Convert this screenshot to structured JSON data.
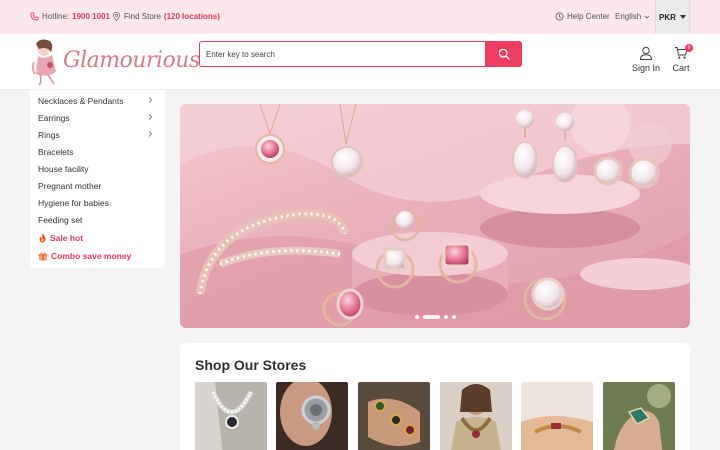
{
  "topbar": {
    "hotline_label": "Hotline:",
    "hotline_number": "1900 1001",
    "find_store_label": "Find Store",
    "store_count": "(120 locations)",
    "help_center": "Help Center",
    "language": "English",
    "currency": "PKR"
  },
  "header": {
    "logo_text": "Glamourious",
    "search_placeholder": "Enter key to search",
    "signin_label": "Sign In",
    "cart_label": "Cart",
    "cart_count": "0"
  },
  "sidebar": {
    "items": [
      {
        "label": "Necklaces & Pendants",
        "has_submenu": true
      },
      {
        "label": "Earrings",
        "has_submenu": true
      },
      {
        "label": "Rings",
        "has_submenu": true
      },
      {
        "label": "Bracelets",
        "has_submenu": false
      },
      {
        "label": "House facility",
        "has_submenu": false
      },
      {
        "label": "Pregnant mother",
        "has_submenu": false
      },
      {
        "label": "Hygiene for babies",
        "has_submenu": false
      },
      {
        "label": "Feeding set",
        "has_submenu": false
      }
    ],
    "promos": [
      {
        "label": "Sale hot",
        "icon": "fire-icon"
      },
      {
        "label": "Combo save money",
        "icon": "gift-icon"
      }
    ]
  },
  "banner": {
    "slide_count": 4,
    "active_slide": 2
  },
  "stores": {
    "title": "Shop Our Stores",
    "thumbnails": [
      "necklace-photo",
      "earring-photo",
      "rings-photo",
      "jewelry-set-photo",
      "bracelet-photo",
      "gemstone-photo"
    ]
  },
  "colors": {
    "accent": "#ef3e62",
    "topbar_bg": "#fbe7ec",
    "page_bg": "#f4f4f6"
  }
}
